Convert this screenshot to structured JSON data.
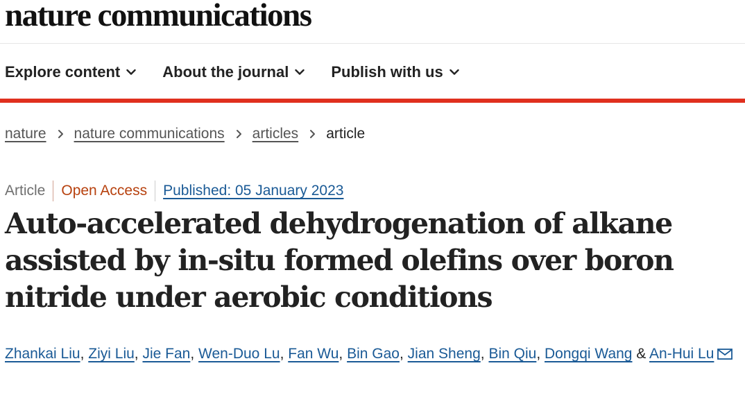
{
  "header": {
    "brand": "nature communications"
  },
  "nav": {
    "items": [
      {
        "label": "Explore content",
        "icon": "chevron-down-icon"
      },
      {
        "label": "About the journal",
        "icon": "chevron-down-icon"
      },
      {
        "label": "Publish with us",
        "icon": "chevron-down-icon"
      }
    ]
  },
  "colors": {
    "accent_bar": "#e0301e",
    "link": "#1a5a96",
    "open_access": "#b7410e"
  },
  "breadcrumb": {
    "items": [
      "nature",
      "nature communications",
      "articles"
    ],
    "current": "article"
  },
  "article": {
    "type": "Article",
    "access": "Open Access",
    "published": "Published: 05 January 2023",
    "title": "Auto-accelerated dehydrogenation of alkane assisted by in-situ formed olefins over boron nitride under aerobic conditions",
    "authors": [
      "Zhankai Liu",
      "Ziyi Liu",
      "Jie Fan",
      "Wen-Duo Lu",
      "Fan Wu",
      "Bin Gao",
      "Jian Sheng",
      "Bin Qiu",
      "Dongqi Wang",
      "An-Hui Lu"
    ],
    "author_sep": ",",
    "author_and": "&"
  }
}
